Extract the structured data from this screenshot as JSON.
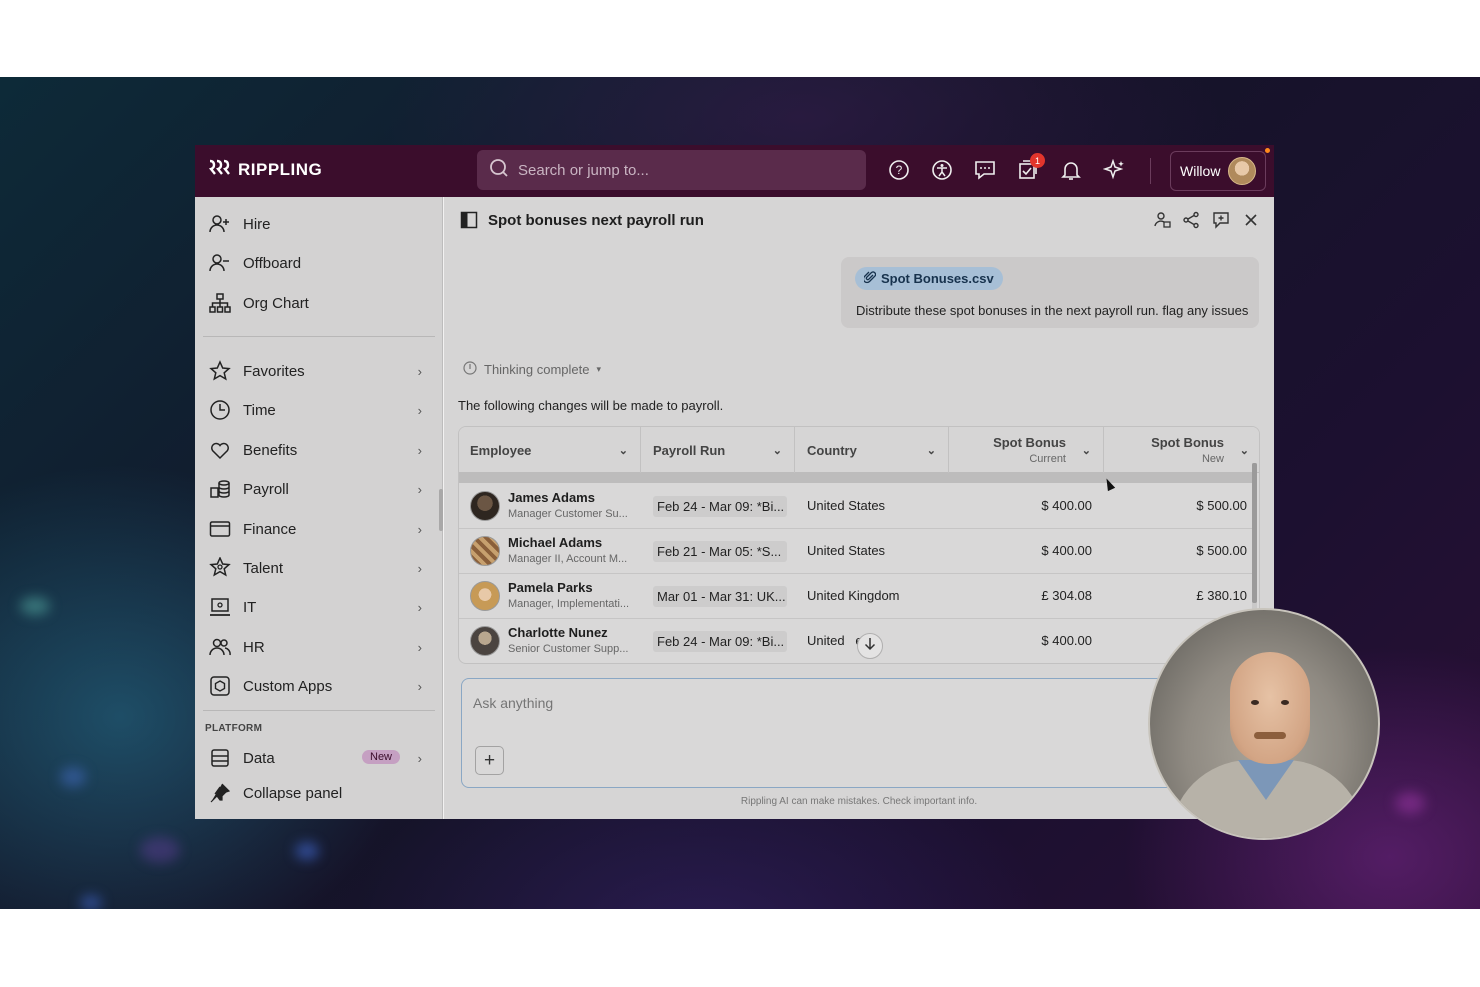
{
  "brand": {
    "name": "RIPPLING",
    "mark": "ꝵ"
  },
  "search": {
    "placeholder": "Search or jump to..."
  },
  "topbar": {
    "notification_count": "1",
    "user_name": "Willow",
    "icons": [
      "help-icon",
      "accessibility-icon",
      "chat-icon",
      "tasks-icon",
      "bell-icon",
      "sparkle-icon"
    ]
  },
  "sidebar": {
    "top_items": [
      {
        "label": "Hire",
        "icon": "add-person-icon"
      },
      {
        "label": "Offboard",
        "icon": "remove-person-icon"
      },
      {
        "label": "Org Chart",
        "icon": "org-chart-icon"
      }
    ],
    "items": [
      {
        "label": "Favorites",
        "icon": "star-icon"
      },
      {
        "label": "Time",
        "icon": "clock-icon"
      },
      {
        "label": "Benefits",
        "icon": "heart-icon"
      },
      {
        "label": "Payroll",
        "icon": "coins-icon"
      },
      {
        "label": "Finance",
        "icon": "card-icon"
      },
      {
        "label": "Talent",
        "icon": "talent-star-icon"
      },
      {
        "label": "IT",
        "icon": "laptop-icon"
      },
      {
        "label": "HR",
        "icon": "people-icon"
      },
      {
        "label": "Custom Apps",
        "icon": "apps-icon"
      }
    ],
    "platform_label": "PLATFORM",
    "data_item": {
      "label": "Data",
      "badge": "New"
    },
    "collapse_label": "Collapse panel"
  },
  "panel": {
    "title": "Spot bonuses next payroll run",
    "attachment": "Spot Bonuses.csv",
    "user_message": "Distribute these spot bonuses in the next payroll run. flag any issues",
    "thinking": "Thinking complete",
    "intro": "The following changes will be made to payroll."
  },
  "table": {
    "headers": {
      "employee": "Employee",
      "payroll_run": "Payroll Run",
      "country": "Country",
      "spot_current": "Spot Bonus",
      "spot_current_sub": "Current",
      "spot_new": "Spot Bonus",
      "spot_new_sub": "New"
    },
    "rows": [
      {
        "name": "James Adams",
        "title": "Manager Customer Su...",
        "run": "Feb 24 - Mar 09: *Bi...",
        "country": "United States",
        "current": "$ 400.00",
        "new": "$ 500.00"
      },
      {
        "name": "Michael Adams",
        "title": "Manager II, Account M...",
        "run": "Feb 21 - Mar 05: *S...",
        "country": "United States",
        "current": "$ 400.00",
        "new": "$ 500.00"
      },
      {
        "name": "Pamela Parks",
        "title": "Manager, Implementati...",
        "run": "Mar 01 - Mar 31: UK...",
        "country": "United Kingdom",
        "current": "£ 304.08",
        "new": "£ 380.10"
      },
      {
        "name": "Charlotte Nunez",
        "title": "Senior Customer Supp...",
        "run": "Feb 24 - Mar 09: *Bi...",
        "country": "United   es",
        "current": "$ 400.00",
        "new": ""
      }
    ]
  },
  "composer": {
    "placeholder": "Ask anything"
  },
  "disclaimer": "Rippling AI can make mistakes. Check important info.",
  "colors": {
    "topbar": "#3b0d2c",
    "accent": "#a7bfd6",
    "badge": "#e2352c"
  }
}
